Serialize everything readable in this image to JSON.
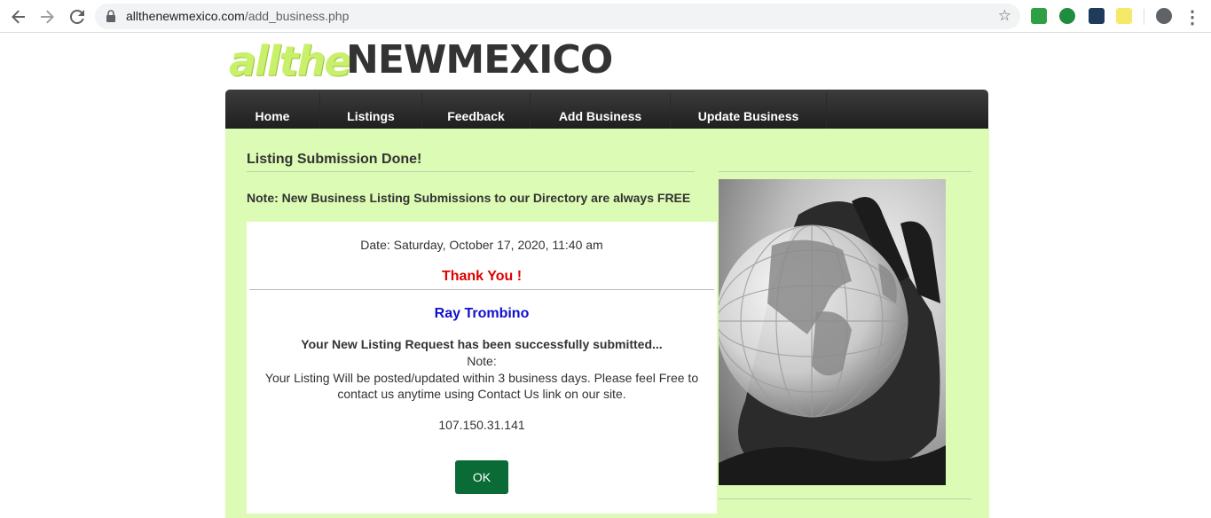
{
  "browser": {
    "url_host": "allthenewmexico.com",
    "url_path": "/add_business.php"
  },
  "logo": {
    "part1": "allthe",
    "part2": "NEWMEXICO"
  },
  "nav": {
    "items": [
      "Home",
      "Listings",
      "Feedback",
      "Add Business",
      "Update Business"
    ]
  },
  "main": {
    "title": "Listing Submission Done!",
    "note": "Note: New Business Listing Submissions to our Directory are always FREE"
  },
  "card": {
    "date": "Date: Saturday, October 17, 2020, 11:40 am",
    "thanks": "Thank You !",
    "name": "Ray Trombino",
    "msg_bold": "Your New Listing Request has been successfully submitted...",
    "msg_note": "Note:",
    "msg_body": "Your Listing Will be posted/updated within 3 business days. Please feel Free to contact us anytime using Contact Us link on our site.",
    "ip": "107.150.31.141",
    "ok_label": "OK"
  },
  "colors": {
    "page_bg": "#dcfbb5",
    "nav_bg": "#2a2a2a",
    "thanks": "#e00000",
    "name": "#1010cc",
    "ok_button": "#0a6b36"
  },
  "icons": {
    "back": "arrow-left-icon",
    "forward": "arrow-right-icon",
    "reload": "reload-icon",
    "lock": "lock-icon",
    "bookmark": "star-icon",
    "profile": "account-circle-icon",
    "menu": "kebab-menu-icon"
  }
}
